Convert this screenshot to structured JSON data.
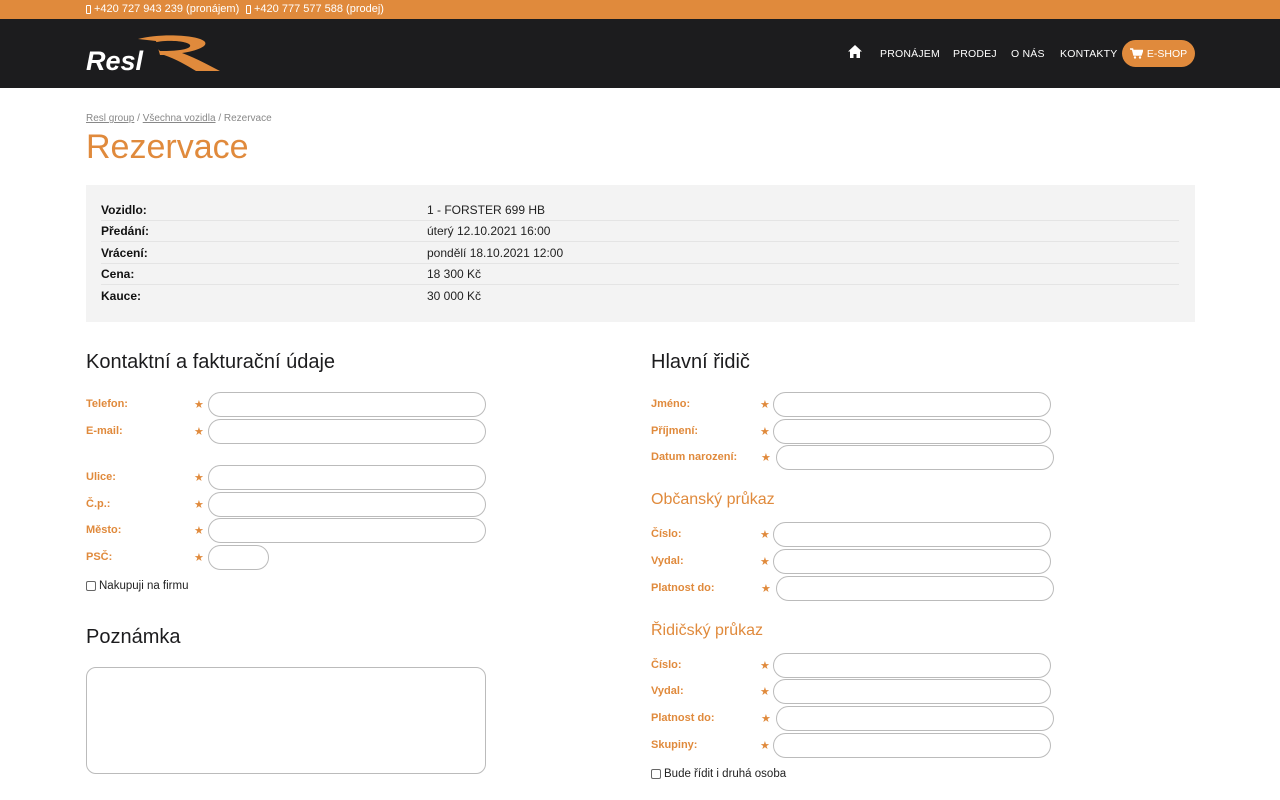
{
  "topbar": {
    "phone_rent": "+420 727 943 239 (pronájem)",
    "phone_sale": "+420 777 577 588 (prodej)"
  },
  "logo": {
    "text": "Resl"
  },
  "nav": {
    "home_icon": "home-icon",
    "items": [
      "PRONÁJEM",
      "PRODEJ",
      "O NÁS",
      "KONTAKTY"
    ],
    "eshop_label": "E-SHOP",
    "eshop_icon": "cart-icon"
  },
  "breadcrumb": [
    "Resl group",
    "Všechna vozidla",
    "Rezervace"
  ],
  "page_title": "Rezervace",
  "summary": [
    {
      "label": "Vozidlo:",
      "value": "1 - FORSTER 699 HB"
    },
    {
      "label": "Předání:",
      "value": "úterý 12.10.2021 16:00"
    },
    {
      "label": "Vrácení:",
      "value": "pondělí 18.10.2021 12:00"
    },
    {
      "label": "Cena:",
      "value": "18 300 Kč"
    },
    {
      "label": "Kauce:",
      "value": "30 000 Kč"
    }
  ],
  "contact": {
    "title": "Kontaktní a fakturační údaje",
    "fields": [
      "Telefon:",
      "E-mail:",
      "Ulice:",
      "Č.p.:",
      "Město:",
      "PSČ:"
    ],
    "company_checkbox": "Nakupuji na firmu"
  },
  "note": {
    "title": "Poznámka"
  },
  "driver": {
    "title": "Hlavní řidič",
    "fields": [
      "Jméno:",
      "Příjmení:",
      "Datum narození:"
    ],
    "id_card_title": "Občanský průkaz",
    "id_card_fields": [
      "Číslo:",
      "Vydal:",
      "Platnost do:"
    ],
    "license_title": "Řidičský průkaz",
    "license_fields": [
      "Číslo:",
      "Vydal:",
      "Platnost do:",
      "Skupiny:"
    ],
    "second_driver_checkbox": "Bude řídit i druhá osoba"
  },
  "required_mark": "★",
  "colors": {
    "accent": "#e08a3c",
    "header_bg": "#1c1c1e"
  }
}
